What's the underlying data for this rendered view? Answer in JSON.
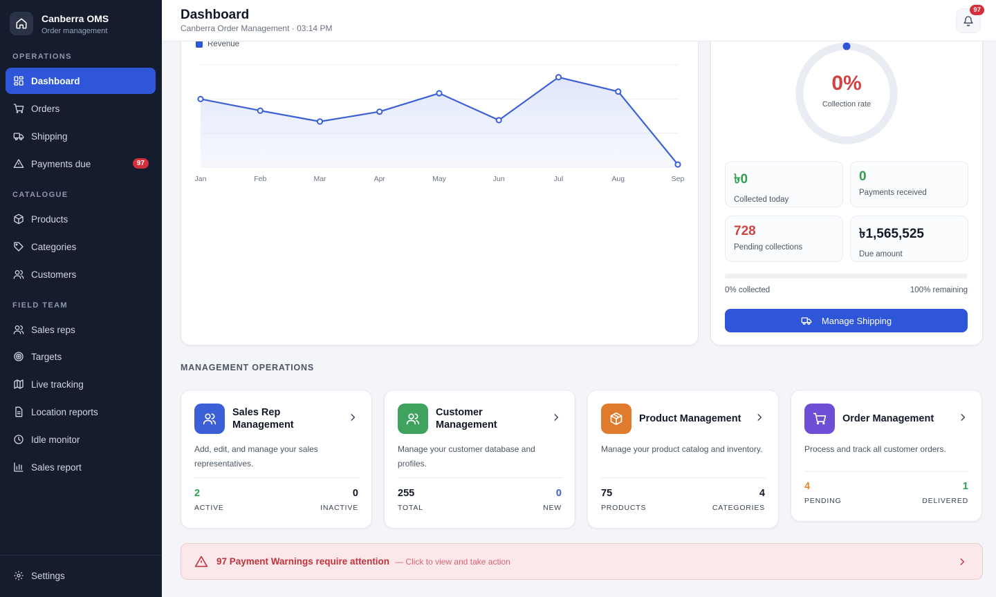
{
  "brand": {
    "name": "Canberra OMS",
    "subtitle": "Order management"
  },
  "sidebar": {
    "sections": [
      "OPERATIONS",
      "CATALOGUE",
      "FIELD TEAM"
    ],
    "items": [
      {
        "label": "Dashboard",
        "icon": "grid-icon",
        "active": true
      },
      {
        "label": "Orders",
        "icon": "cart-icon"
      },
      {
        "label": "Shipping",
        "icon": "truck-icon"
      },
      {
        "label": "Payments due",
        "icon": "warning-icon",
        "badge": "97"
      },
      {
        "label": "Products",
        "icon": "box-icon"
      },
      {
        "label": "Categories",
        "icon": "tag-icon"
      },
      {
        "label": "Customers",
        "icon": "users-icon"
      },
      {
        "label": "Sales reps",
        "icon": "users-icon"
      },
      {
        "label": "Targets",
        "icon": "target-icon"
      },
      {
        "label": "Live tracking",
        "icon": "map-icon"
      },
      {
        "label": "Location reports",
        "icon": "document-icon"
      },
      {
        "label": "Idle monitor",
        "icon": "clock-icon"
      },
      {
        "label": "Sales report",
        "icon": "bar-chart-icon"
      }
    ],
    "settings": "Settings"
  },
  "header": {
    "title": "Dashboard",
    "subtitle": "Canberra Order Management · 03:14 PM",
    "notification_count": "97"
  },
  "chart_data": {
    "type": "area",
    "categories": [
      "Jan",
      "Feb",
      "Mar",
      "Apr",
      "May",
      "Jun",
      "Jul",
      "Aug",
      "Sep"
    ],
    "series": [
      {
        "name": "Revenue",
        "values": [
          2.0,
          1.66,
          1.34,
          1.63,
          2.17,
          1.38,
          2.64,
          2.22,
          0.08
        ]
      }
    ],
    "ylim": [
      0,
      3
    ],
    "grid": true,
    "legend": "top-left",
    "colors": {
      "line": "#3b5fd6",
      "fill": "#dfe6fb"
    }
  },
  "collection": {
    "rate_value": "0%",
    "rate_label": "Collection rate",
    "rate_fraction": 0,
    "stats": [
      {
        "value": "৳0",
        "label": "Collected today",
        "color": "#2e9e4f"
      },
      {
        "value": "0",
        "label": "Payments received",
        "color": "#2e9e4f"
      },
      {
        "value": "728",
        "label": "Pending collections",
        "color": "#d14343"
      },
      {
        "value": "৳1,565,525",
        "label": "Due amount",
        "color": "#111827"
      }
    ],
    "progress_fraction": 0,
    "collected_text": "0% collected",
    "remaining_text": "100% remaining",
    "button_label": "Manage Shipping"
  },
  "management": {
    "title": "MANAGEMENT OPERATIONS",
    "cards": [
      {
        "title_lines": [
          "Sales Rep",
          "Management"
        ],
        "desc": "Add, edit, and manage your sales representatives.",
        "left_value": "2",
        "left_label": "ACTIVE",
        "right_value": "0",
        "right_label": "INACTIVE",
        "accent": "#3b5fd6",
        "left_color": "#2e9e4f",
        "right_color": "#111827"
      },
      {
        "title_lines": [
          "Customer",
          "Management"
        ],
        "desc": "Manage your customer database and profiles.",
        "left_value": "255",
        "left_label": "TOTAL",
        "right_value": "0",
        "right_label": "NEW",
        "accent": "#3fa35f",
        "left_color": "#111827",
        "right_color": "#3b5fd6"
      },
      {
        "title_lines": [
          "Product Management"
        ],
        "desc": "Manage your product catalog and inventory.",
        "left_value": "75",
        "left_label": "PRODUCTS",
        "right_value": "4",
        "right_label": "CATEGORIES",
        "accent": "#e07b2e",
        "left_color": "#111827",
        "right_color": "#111827"
      },
      {
        "title_lines": [
          "Order Management"
        ],
        "desc": "Process and track all customer orders.",
        "left_value": "4",
        "left_label": "PENDING",
        "right_value": "1",
        "right_label": "DELIVERED",
        "accent": "#6d4fd6",
        "left_color": "#e08a2e",
        "right_color": "#2e9e4f"
      }
    ]
  },
  "alert": {
    "title": "97 Payment Warnings require attention",
    "subtitle": "— Click to view and take action"
  }
}
